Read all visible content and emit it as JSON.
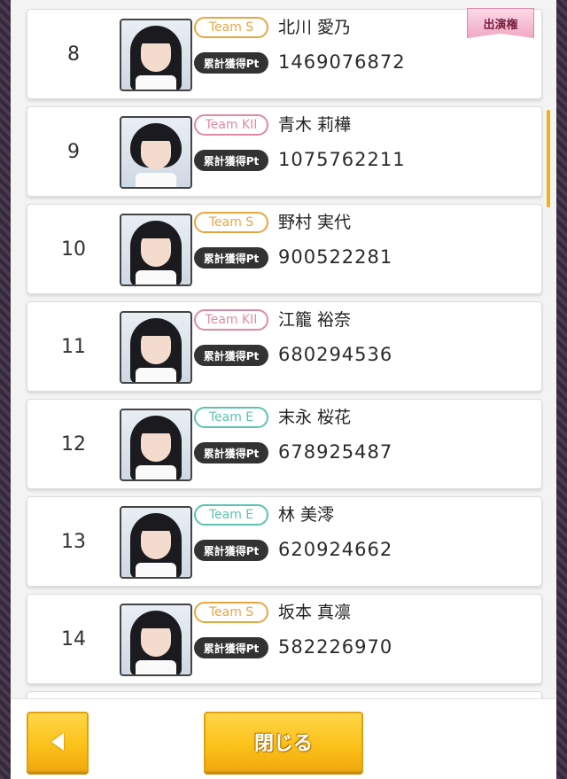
{
  "rankings": [
    {
      "rank": "8",
      "team": "Team S",
      "team_color": "#e8a640",
      "name": "北川 愛乃",
      "pt_label": "累計獲得Pt",
      "points": "1469076872",
      "appear_badge": "出演権"
    },
    {
      "rank": "9",
      "team": "Team KII",
      "team_color": "#e08aa3",
      "name": "青木 莉樺",
      "pt_label": "累計獲得Pt",
      "points": "1075762211"
    },
    {
      "rank": "10",
      "team": "Team S",
      "team_color": "#e8a640",
      "name": "野村 実代",
      "pt_label": "累計獲得Pt",
      "points": "900522281"
    },
    {
      "rank": "11",
      "team": "Team KII",
      "team_color": "#e08aa3",
      "name": "江籠 裕奈",
      "pt_label": "累計獲得Pt",
      "points": "680294536"
    },
    {
      "rank": "12",
      "team": "Team E",
      "team_color": "#5cc4b0",
      "name": "末永 桜花",
      "pt_label": "累計獲得Pt",
      "points": "678925487"
    },
    {
      "rank": "13",
      "team": "Team E",
      "team_color": "#5cc4b0",
      "name": "林 美澪",
      "pt_label": "累計獲得Pt",
      "points": "620924662"
    },
    {
      "rank": "14",
      "team": "Team S",
      "team_color": "#e8a640",
      "name": "坂本 真凛",
      "pt_label": "累計獲得Pt",
      "points": "582226970"
    }
  ],
  "footer": {
    "back_icon": "triangle-left-icon",
    "close_label": "閉じる"
  },
  "colors": {
    "accent": "#fbc21b",
    "scrollbar": "#f0b21a"
  }
}
